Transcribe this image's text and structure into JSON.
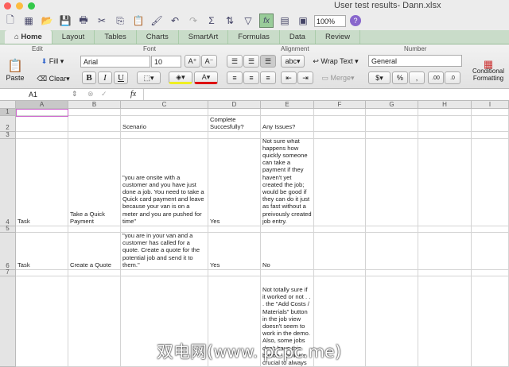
{
  "window": {
    "title": "User test results- Dann.xlsx"
  },
  "toolbar": {
    "zoom": "100%"
  },
  "tabs": [
    "Home",
    "Layout",
    "Tables",
    "Charts",
    "SmartArt",
    "Formulas",
    "Data",
    "Review"
  ],
  "ribbon": {
    "groups": {
      "edit": "Edit",
      "font": "Font",
      "alignment": "Alignment",
      "number": "Number"
    },
    "paste": "Paste",
    "fill": "Fill",
    "clear": "Clear",
    "font_name": "Arial",
    "font_size": "10",
    "bold": "B",
    "italic": "I",
    "underline": "U",
    "wrap_text": "Wrap Text",
    "merge": "Merge",
    "abc": "abc",
    "number_format": "General",
    "percent": "%",
    "comma": ",",
    "cond_format": "Conditional Formatting"
  },
  "formula_bar": {
    "cell_ref": "A1",
    "fx": "fx",
    "value": ""
  },
  "columns": [
    "A",
    "B",
    "C",
    "D",
    "E",
    "F",
    "G",
    "H",
    "I"
  ],
  "rows": [
    "1",
    "2",
    "3",
    "4",
    "5",
    "6",
    "7",
    ""
  ],
  "cells": {
    "C2": "Scenario",
    "D2": "Complete Succesfully?",
    "E2": "Any Issues?",
    "A4": "Task",
    "B4": "Take a Quick Payment",
    "C4": "\"you are onsite with a customer and you have just done a job. You need to take a Quick card payment and leave because your van is on a meter and you are pushed for time\"",
    "D4": "Yes",
    "E4": "Not sure what happens how quickly someone can take a payment if they haven't yet created the job; would be good if they can do it just as fast without a preivously created job entry.",
    "A6": "Task",
    "B6": "Create a Quote",
    "C6": "\"you are in your van and a customer has called for a quote. Create a quote for the potential job and send it to them.\"",
    "D6": "Yes",
    "E6": "No",
    "E8": "Not totally sure if it worked or not . . . the \"Add Costs / Materials\" button in the job view doesn't seem to work in the demo. Also, some jobs don't have this button I think it's crucial to always have this"
  },
  "watermark": "双电网(www. pcpc.me)"
}
